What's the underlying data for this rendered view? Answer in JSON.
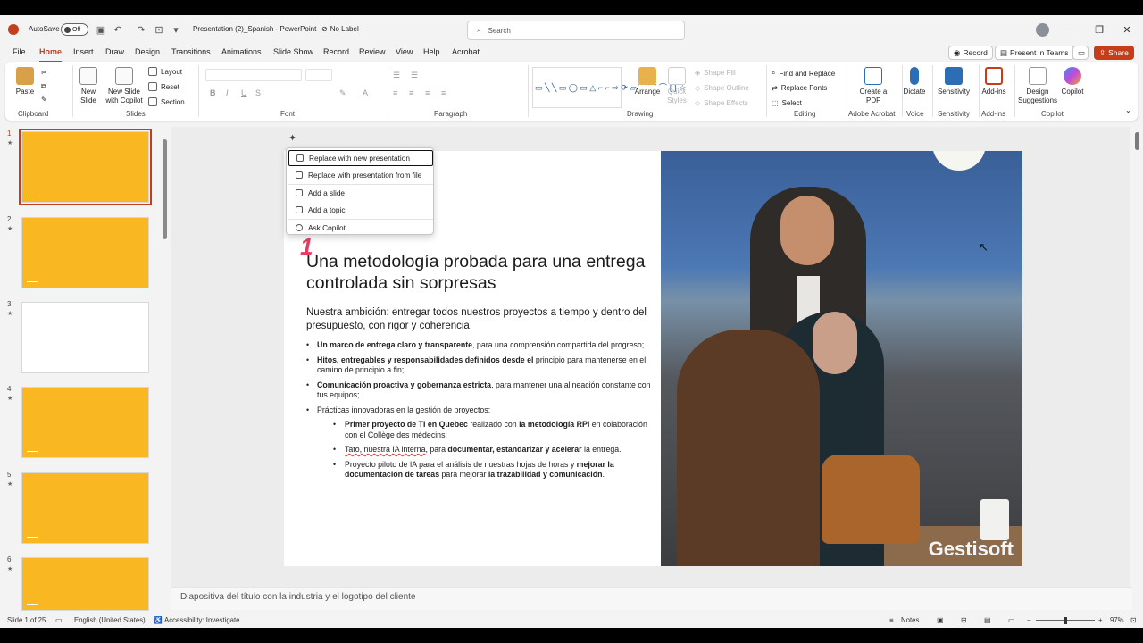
{
  "titlebar": {
    "autosave_label": "AutoSave",
    "autosave_state": "Off",
    "document_title": "Presentation (2)_Spanish  -  PowerPoint",
    "sensitivity_label": "No Label",
    "search_placeholder": "Search"
  },
  "menu": {
    "tabs": [
      "File",
      "Home",
      "Insert",
      "Draw",
      "Design",
      "Transitions",
      "Animations",
      "Slide Show",
      "Record",
      "Review",
      "View",
      "Help",
      "Acrobat"
    ],
    "active_tab": "Home",
    "record_label": "Record",
    "present_teams_label": "Present in Teams",
    "share_label": "Share"
  },
  "ribbon": {
    "clipboard": {
      "paste": "Paste",
      "group": "Clipboard"
    },
    "slides": {
      "new_slide": "New Slide",
      "new_slide_copilot": "New Slide with Copilot",
      "layout": "Layout",
      "reset": "Reset",
      "section": "Section",
      "group": "Slides"
    },
    "font": {
      "group": "Font"
    },
    "paragraph": {
      "group": "Paragraph"
    },
    "drawing": {
      "arrange": "Arrange",
      "quick_styles": "Quick Styles",
      "shape_fill": "Shape Fill",
      "shape_outline": "Shape Outline",
      "shape_effects": "Shape Effects",
      "group": "Drawing"
    },
    "editing": {
      "find_replace": "Find and Replace",
      "replace_fonts": "Replace Fonts",
      "select": "Select",
      "group": "Editing"
    },
    "acrobat": {
      "create_pdf": "Create a PDF",
      "group": "Adobe Acrobat"
    },
    "voice": {
      "dictate": "Dictate",
      "group": "Voice"
    },
    "sensitivity": {
      "sensitivity": "Sensitivity",
      "group": "Sensitivity"
    },
    "addins": {
      "addins": "Add-ins",
      "group": "Add-ins"
    },
    "copilot": {
      "design_suggestions": "Design Suggestions",
      "copilot": "Copilot",
      "group": "Copilot"
    }
  },
  "thumbnails": {
    "numbers": [
      "1",
      "2",
      "3",
      "4",
      "5",
      "6"
    ],
    "selected": 1
  },
  "context_menu": {
    "items": [
      "Replace with new presentation",
      "Replace with presentation from file",
      "Add a slide",
      "Add a topic",
      "Ask Copilot"
    ]
  },
  "slide": {
    "number_marker": "1",
    "title": "Una metodología probada para una entrega controlada sin sorpresas",
    "subtitle": "Nuestra ambición: entregar todos nuestros proyectos a tiempo y dentro del presupuesto, con rigor y coherencia.",
    "bullets": [
      {
        "bold": "Un marco de entrega claro y transparente",
        "text": ", para una comprensión compartida del progreso;"
      },
      {
        "bold": "Hitos, entregables y responsabilidades definidos desde el",
        "text": "  principio para mantenerse en el camino de principio a fin;"
      },
      {
        "bold": "Comunicación proactiva y gobernanza estricta",
        "text": ", para mantener una alineación constante con tus equipos;"
      },
      {
        "bold": "",
        "text": "Prácticas innovadoras en la gestión de proyectos:"
      }
    ],
    "sub_bullets": {
      "s1_b1": "Primer proyecto de TI en Quebec",
      "s1_t1": " realizado con ",
      "s1_b2": "la metodología RPI",
      "s1_t2": " en colaboración con el Collège des médecins;",
      "s2_u": "Tato, nuestra IA interna",
      "s2_t1": ", para ",
      "s2_b": "documentar, estandarizar y acelerar",
      "s2_t2": " la entrega.",
      "s3_t1": "Proyecto piloto de IA para el análisis de nuestras hojas de horas y ",
      "s3_b1": "mejorar la documentación de tareas",
      "s3_t2": " para mejorar ",
      "s3_b2": "la trazabilidad y comunicación",
      "s3_t3": "."
    },
    "brand": "Gestisoft"
  },
  "notes": "Diapositiva del título con la industria y el logotipo del cliente",
  "status": {
    "slide_of": "Slide 1 of 25",
    "language": "English (United States)",
    "accessibility": "Accessibility: Investigate",
    "notes_label": "Notes",
    "zoom": "97%"
  },
  "colors": {
    "accent": "#c43e1c",
    "thumbnail": "#f9b822",
    "marker": "#e93b62"
  }
}
